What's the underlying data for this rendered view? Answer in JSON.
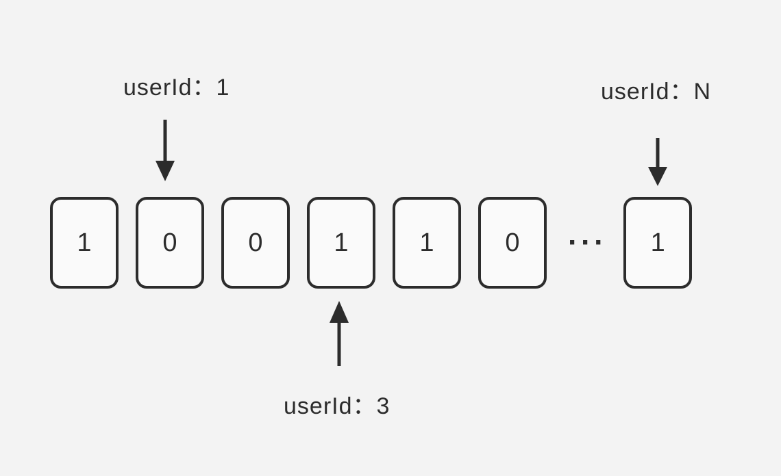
{
  "labels": {
    "topLeft": "userId：1",
    "topRight": "userId：N",
    "bottom": "userId：3"
  },
  "cells": {
    "c0": "1",
    "c1": "0",
    "c2": "0",
    "c3": "1",
    "c4": "1",
    "c5": "0",
    "cLast": "1"
  },
  "ellipsis": "···"
}
